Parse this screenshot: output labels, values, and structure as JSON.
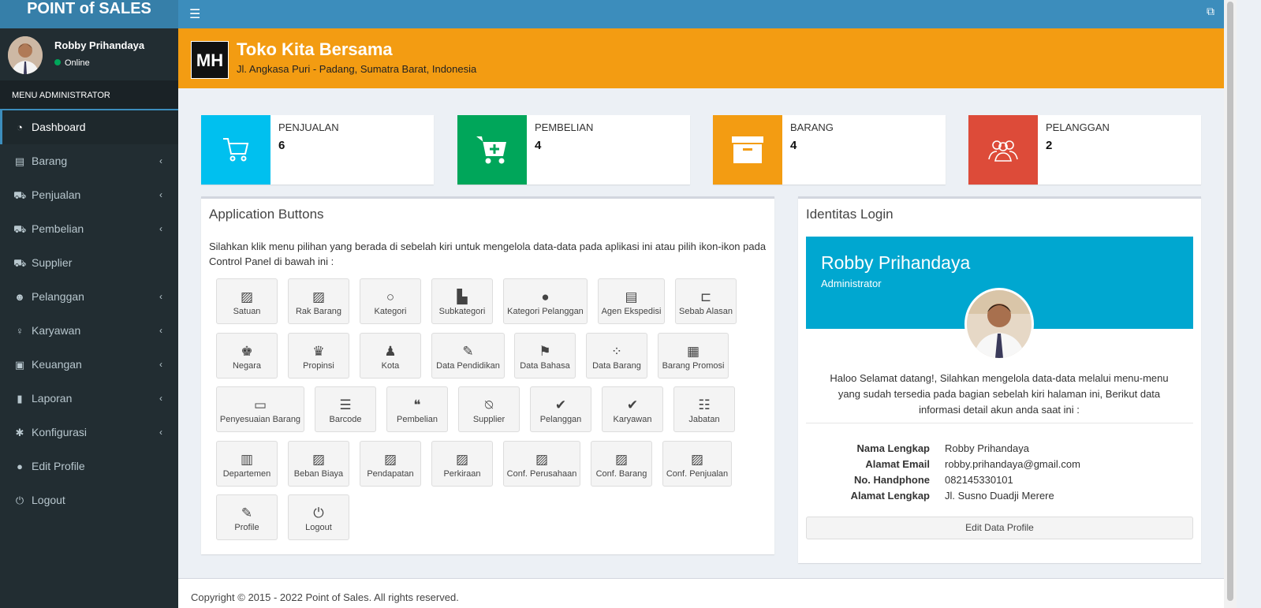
{
  "app": {
    "title": "POINT of SALES"
  },
  "user": {
    "name": "Robby Prihandaya",
    "status": "Online"
  },
  "sidebar": {
    "header": "MENU ADMINISTRATOR",
    "items": [
      {
        "label": "Dashboard",
        "icon": "dashboard-icon"
      },
      {
        "label": "Barang",
        "icon": "archive-icon"
      },
      {
        "label": "Penjualan",
        "icon": "cart-icon"
      },
      {
        "label": "Pembelian",
        "icon": "cart-plus-icon"
      },
      {
        "label": "Supplier",
        "icon": "truck-icon"
      },
      {
        "label": "Pelanggan",
        "icon": "users-icon"
      },
      {
        "label": "Karyawan",
        "icon": "person-icon"
      },
      {
        "label": "Keuangan",
        "icon": "money-icon"
      },
      {
        "label": "Laporan",
        "icon": "book-icon"
      },
      {
        "label": "Konfigurasi",
        "icon": "gear-icon"
      },
      {
        "label": "Edit Profile",
        "icon": "user-icon"
      },
      {
        "label": "Logout",
        "icon": "power-icon"
      }
    ]
  },
  "store": {
    "logo": "MH",
    "name": "Toko Kita Bersama",
    "address": "Jl. Angkasa Puri - Padang, Sumatra Barat, Indonesia"
  },
  "stats": [
    {
      "label": "PENJUALAN",
      "value": "6",
      "color": "#00c0ef"
    },
    {
      "label": "PEMBELIAN",
      "value": "4",
      "color": "#00a65a"
    },
    {
      "label": "BARANG",
      "value": "4",
      "color": "#f39c12"
    },
    {
      "label": "PELANGGAN",
      "value": "2",
      "color": "#dd4b39"
    }
  ],
  "app_buttons": {
    "title": "Application Buttons",
    "description": "Silahkan klik menu pilihan yang berada di sebelah kiri untuk mengelola data-data pada aplikasi ini atau pilih ikon-ikon pada Control Panel di bawah ini :",
    "buttons": [
      {
        "label": "Satuan",
        "icon": "image-icon"
      },
      {
        "label": "Rak Barang",
        "icon": "image-icon"
      },
      {
        "label": "Kategori",
        "icon": "circle-outline-icon"
      },
      {
        "label": "Subkategori",
        "icon": "file-icon"
      },
      {
        "label": "Kategori Pelanggan",
        "icon": "circle-icon"
      },
      {
        "label": "Agen Ekspedisi",
        "icon": "file-text-icon"
      },
      {
        "label": "Sebab Alasan",
        "icon": "bed-icon"
      },
      {
        "label": "Negara",
        "icon": "chess-king-icon"
      },
      {
        "label": "Propinsi",
        "icon": "chess-queen-icon"
      },
      {
        "label": "Kota",
        "icon": "chess-pawn-icon"
      },
      {
        "label": "Data Pendidikan",
        "icon": "pencil-icon"
      },
      {
        "label": "Data Bahasa",
        "icon": "flag-icon"
      },
      {
        "label": "Data Barang",
        "icon": "grid-icon"
      },
      {
        "label": "Barang Promosi",
        "icon": "th-large-icon"
      },
      {
        "label": "Penyesuaian Barang",
        "icon": "monitor-icon"
      },
      {
        "label": "Barcode",
        "icon": "bars-icon"
      },
      {
        "label": "Pembelian",
        "icon": "comments-icon"
      },
      {
        "label": "Supplier",
        "icon": "bell-slash-icon"
      },
      {
        "label": "Pelanggan",
        "icon": "check-icon"
      },
      {
        "label": "Karyawan",
        "icon": "check-icon"
      },
      {
        "label": "Jabatan",
        "icon": "list-icon"
      },
      {
        "label": "Departemen",
        "icon": "bar-chart-icon"
      },
      {
        "label": "Beban Biaya",
        "icon": "image-icon"
      },
      {
        "label": "Pendapatan",
        "icon": "image-icon"
      },
      {
        "label": "Perkiraan",
        "icon": "image-icon"
      },
      {
        "label": "Conf. Perusahaan",
        "icon": "image-icon"
      },
      {
        "label": "Conf. Barang",
        "icon": "image-icon"
      },
      {
        "label": "Conf. Penjualan",
        "icon": "image-icon"
      },
      {
        "label": "Profile",
        "icon": "edit-icon"
      },
      {
        "label": "Logout",
        "icon": "power-icon"
      }
    ]
  },
  "identity": {
    "title": "Identitas Login",
    "name": "Robby Prihandaya",
    "role": "Administrator",
    "welcome": "Haloo Selamat datang!, Silahkan mengelola data-data melalui menu-menu yang sudah tersedia pada bagian sebelah kiri halaman ini, Berikut data informasi detail akun anda saat ini :",
    "fields": [
      {
        "key": "Nama Lengkap",
        "value": "Robby Prihandaya"
      },
      {
        "key": "Alamat Email",
        "value": "robby.prihandaya@gmail.com"
      },
      {
        "key": "No. Handphone",
        "value": "082145330101"
      },
      {
        "key": "Alamat Lengkap",
        "value": "Jl. Susno Duadji Merere"
      }
    ],
    "edit_button": "Edit Data Profile"
  },
  "footer": {
    "text": "Copyright © 2015 - 2022 Point of Sales. All rights reserved."
  }
}
